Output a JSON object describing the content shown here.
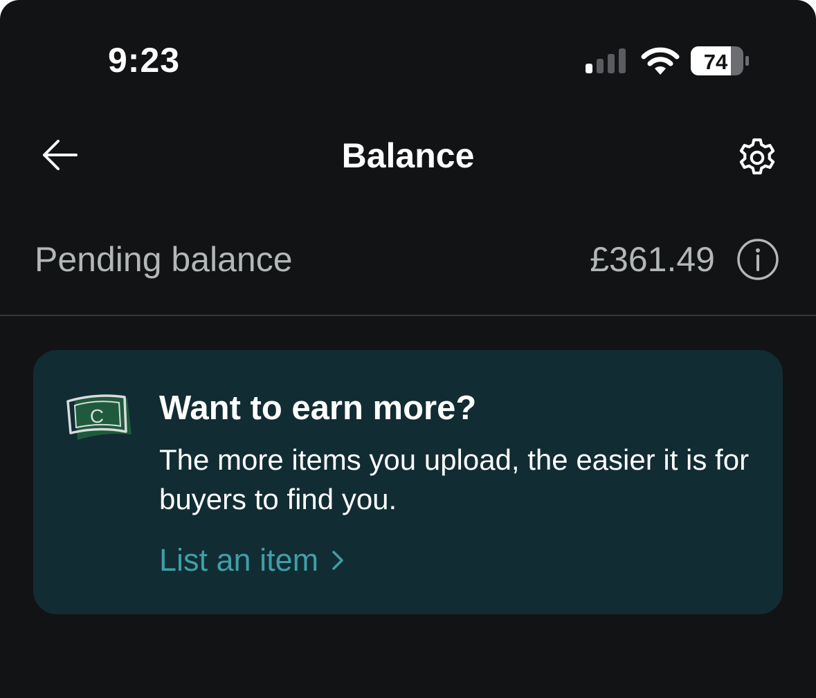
{
  "status_bar": {
    "time": "9:23",
    "battery_level": "74",
    "signal_bars_active": 1,
    "signal_bars_total": 4
  },
  "header": {
    "title": "Balance",
    "back_icon": "arrow-left-icon",
    "settings_icon": "gear-icon"
  },
  "pending": {
    "label": "Pending balance",
    "amount": "£361.49",
    "info_icon": "info-icon"
  },
  "promo": {
    "title": "Want to earn more?",
    "body": "The more items you upload, the easier it is for buyers to find you.",
    "link_label": "List an item",
    "icon": "money-note-icon",
    "note_letter": "C"
  },
  "colors": {
    "background": "#121315",
    "card": "#122c33",
    "link": "#3f9fa8",
    "muted_text": "#b3b7b8",
    "note_green": "#1f5a3c"
  }
}
